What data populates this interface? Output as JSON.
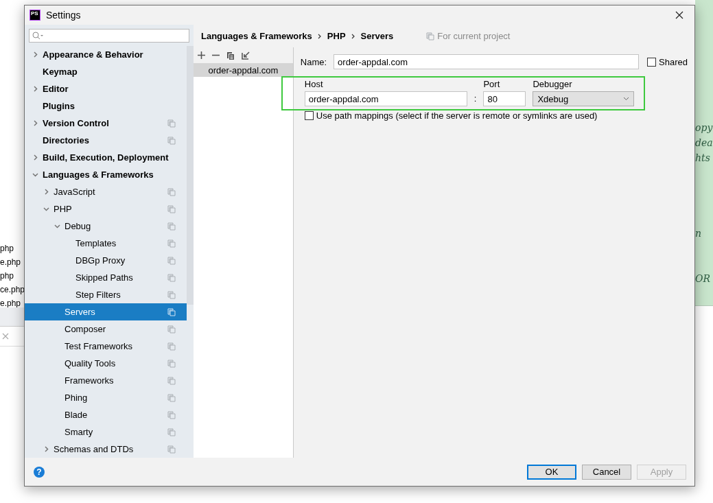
{
  "background": {
    "files": [
      "php",
      "e.php",
      "php",
      "ce.php",
      "e.php"
    ],
    "editor_fragments": [
      "opy",
      "dea",
      "hts",
      "n",
      "OR"
    ]
  },
  "window": {
    "logo_text": "PS",
    "title": "Settings"
  },
  "sidebar": {
    "items": [
      {
        "label": "Appearance & Behavior",
        "expanded": false,
        "project_scope": false,
        "selected": false
      },
      {
        "label": "Keymap",
        "project_scope": false,
        "selected": false
      },
      {
        "label": "Editor",
        "expanded": false,
        "project_scope": false,
        "selected": false
      },
      {
        "label": "Plugins",
        "project_scope": false,
        "selected": false
      },
      {
        "label": "Version Control",
        "expanded": false,
        "project_scope": true,
        "selected": false
      },
      {
        "label": "Directories",
        "project_scope": true,
        "selected": false
      },
      {
        "label": "Build, Execution, Deployment",
        "expanded": false,
        "project_scope": false,
        "selected": false
      },
      {
        "label": "Languages & Frameworks",
        "expanded": true,
        "project_scope": false,
        "selected": false,
        "children": [
          {
            "label": "JavaScript",
            "expanded": false,
            "project_scope": true,
            "selected": false
          },
          {
            "label": "PHP",
            "expanded": true,
            "project_scope": true,
            "selected": false,
            "children": [
              {
                "label": "Debug",
                "expanded": true,
                "project_scope": true,
                "selected": false,
                "children": [
                  {
                    "label": "Templates",
                    "project_scope": true,
                    "selected": false
                  },
                  {
                    "label": "DBGp Proxy",
                    "project_scope": true,
                    "selected": false
                  },
                  {
                    "label": "Skipped Paths",
                    "project_scope": true,
                    "selected": false
                  },
                  {
                    "label": "Step Filters",
                    "project_scope": true,
                    "selected": false
                  }
                ]
              },
              {
                "label": "Servers",
                "project_scope": true,
                "selected": true
              },
              {
                "label": "Composer",
                "project_scope": true,
                "selected": false
              },
              {
                "label": "Test Frameworks",
                "project_scope": true,
                "selected": false
              },
              {
                "label": "Quality Tools",
                "project_scope": true,
                "selected": false
              },
              {
                "label": "Frameworks",
                "project_scope": true,
                "selected": false
              },
              {
                "label": "Phing",
                "project_scope": true,
                "selected": false
              },
              {
                "label": "Blade",
                "project_scope": true,
                "selected": false
              },
              {
                "label": "Smarty",
                "project_scope": true,
                "selected": false
              }
            ]
          },
          {
            "label": "Schemas and DTDs",
            "expanded": false,
            "project_scope": true,
            "selected": false
          }
        ]
      }
    ]
  },
  "breadcrumb": [
    "Languages & Frameworks",
    "PHP",
    "Servers"
  ],
  "scope_note": "For current project",
  "servers": [
    {
      "name": "order-appdal.com",
      "selected": true
    }
  ],
  "form": {
    "name_label": "Name:",
    "name_value": "order-appdal.com",
    "shared_label": "Shared",
    "shared_checked": false,
    "connection": {
      "highlighted": true,
      "host_label": "Host",
      "host_value": "order-appdal.com",
      "separator": ":",
      "port_label": "Port",
      "port_value": "80",
      "debugger_label": "Debugger",
      "debugger_value": "Xdebug"
    },
    "path_mappings_label": "Use path mappings (select if the server is remote or symlinks are used)",
    "path_mappings_checked": false
  },
  "help": "?",
  "buttons": [
    {
      "label": "OK",
      "kind": "default"
    },
    {
      "label": "Cancel",
      "kind": "normal"
    },
    {
      "label": "Apply",
      "kind": "disabled"
    }
  ]
}
